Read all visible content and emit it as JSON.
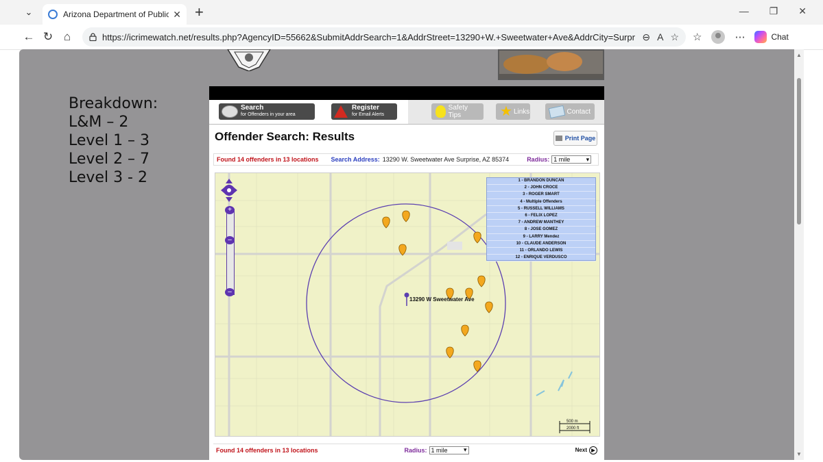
{
  "browser": {
    "tab_title": "Arizona Department of Public Safe",
    "url": "https://icrimewatch.net/results.php?AgencyID=55662&SubmitAddrSearch=1&AddrStreet=13290+W.+Sweetwater+Ave&AddrCity=Surpr...",
    "chat_label": "Chat"
  },
  "overlay": {
    "lines": [
      "Breakdown:",
      "L&M – 2",
      "Level 1 – 3",
      "Level 2 – 7",
      "Level 3 - 2"
    ]
  },
  "nav": {
    "search_big": "Search",
    "search_small": "for Offenders in your area",
    "register_big": "Register",
    "register_small": "for Email Alerts",
    "safety": "Safety Tips",
    "links": "Links",
    "contact": "Contact"
  },
  "results": {
    "title": "Offender Search: Results",
    "print_label": "Print Page",
    "found": "Found 14 offenders in 13 locations",
    "search_address_label": "Search Address:",
    "search_address_value": "13290 W. Sweetwater Ave Surprise, AZ 85374",
    "radius_label": "Radius:",
    "radius_value": "1 mile",
    "next_label": "Next"
  },
  "map": {
    "center_label": "13290 W Sweetwater Ave",
    "scale_top": "500 m",
    "scale_bottom": "2000 ft",
    "legend": [
      "1 - BRANDON DUNCAN",
      "2 - JOHN CROCE",
      "3 - ROGER SMART",
      "4 - Multiple Offenders",
      "5 - RUSSELL WILLIAMS",
      "6 - FELIX LOPEZ",
      "7 - ANDREW MANTHEY",
      "8 - JOSE GOMEZ",
      "9 - LARRY Mendez",
      "10 - CLAUDE ANDERSON",
      "11 - ORLANDO LEWIS",
      "12 - ENRIQUE VERDUSCO"
    ],
    "colors": {
      "marker": "#f3a81f",
      "radius_circle": "#5b3fb0",
      "road": "#d8d8d8",
      "land": "#f0f2c8"
    }
  }
}
